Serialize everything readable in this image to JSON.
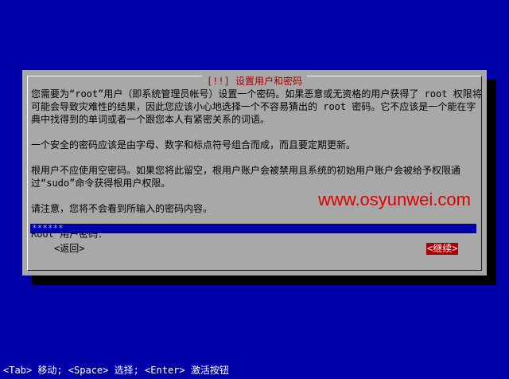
{
  "dialog": {
    "title": "[!!] 设置用户和密码",
    "paragraphs": [
      "您需要为“root”用户（即系统管理员帐号）设置一个密码。如果恶意或无资格的用户获得了 root 权限将可能会导致灾难性的结果，因此您应该小心地选择一个不容易猜出的 root 密码。它不应该是一个能在字典中找得到的单词或者一个跟您本人有紧密关系的词语。",
      "一个安全的密码应该是由字母、数字和标点符号组合而成，而且要定期更新。",
      "根用户不应使用空密码。如果您将此留空，根用户账户会被禁用且系统的初始用户账户会被给予权限通过“sudo”命令获得根用户权限。",
      "请注意，您将不会看到所输入的密码内容。"
    ],
    "field_label": "Root 用户密码：",
    "password_value": "******",
    "back_button": "<返回>",
    "continue_button": "<继续>"
  },
  "watermark": "www.osyunwei.com",
  "statusbar": "<Tab> 移动; <Space> 选择; <Enter> 激活按钮",
  "colors": {
    "background": "#0000a8",
    "dialog": "#a8a8a8",
    "title": "#a80000",
    "field": "#0000a8",
    "selected_button": "#a80000",
    "watermark": "#e00000"
  }
}
